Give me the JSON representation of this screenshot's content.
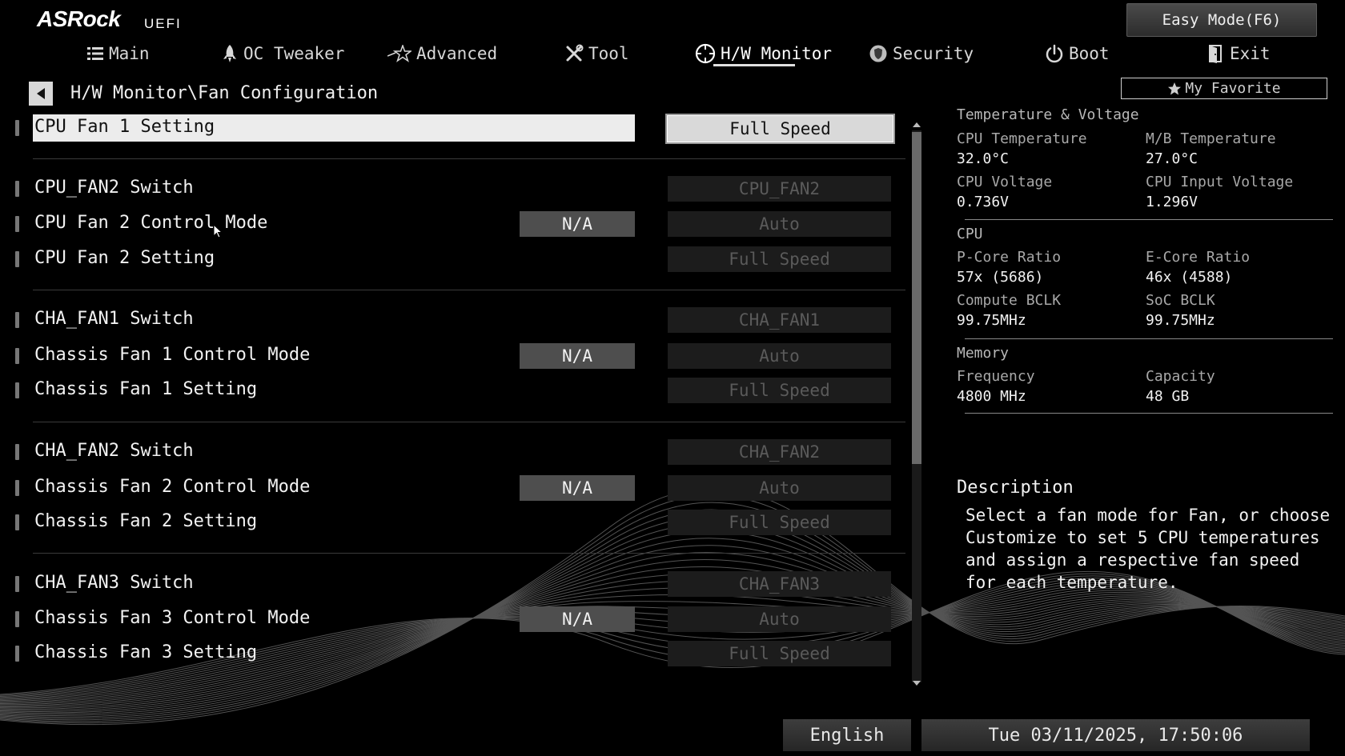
{
  "header": {
    "brand": "ASRock",
    "brand_suffix": "UEFI",
    "easy_mode_label": "Easy Mode(F6)"
  },
  "nav": {
    "tabs": [
      {
        "label": "Main",
        "icon": "list-icon"
      },
      {
        "label": "OC Tweaker",
        "icon": "rocket-icon"
      },
      {
        "label": "Advanced",
        "icon": "star-icon"
      },
      {
        "label": "Tool",
        "icon": "tools-icon"
      },
      {
        "label": "H/W Monitor",
        "icon": "monitor-icon",
        "active": true
      },
      {
        "label": "Security",
        "icon": "shield-icon"
      },
      {
        "label": "Boot",
        "icon": "power-icon"
      },
      {
        "label": "Exit",
        "icon": "exit-icon"
      }
    ]
  },
  "breadcrumb": {
    "path": "H/W Monitor\\Fan Configuration"
  },
  "favorite": {
    "label": "My Favorite"
  },
  "settings": [
    {
      "label": "CPU Fan 1 Setting",
      "value": "Full Speed",
      "selected": true
    },
    {
      "label": "CPU_FAN2 Switch",
      "value": "CPU_FAN2"
    },
    {
      "label": "CPU Fan 2 Control Mode",
      "status": "N/A",
      "value": "Auto"
    },
    {
      "label": "CPU Fan 2 Setting",
      "value": "Full Speed"
    },
    {
      "label": "CHA_FAN1 Switch",
      "value": "CHA_FAN1"
    },
    {
      "label": "Chassis Fan 1 Control Mode",
      "status": "N/A",
      "value": "Auto"
    },
    {
      "label": "Chassis Fan 1 Setting",
      "value": "Full Speed"
    },
    {
      "label": "CHA_FAN2 Switch",
      "value": "CHA_FAN2"
    },
    {
      "label": "Chassis Fan 2 Control Mode",
      "status": "N/A",
      "value": "Auto"
    },
    {
      "label": "Chassis Fan 2 Setting",
      "value": "Full Speed"
    },
    {
      "label": "CHA_FAN3 Switch",
      "value": "CHA_FAN3"
    },
    {
      "label": "Chassis Fan 3 Control Mode",
      "status": "N/A",
      "value": "Auto"
    },
    {
      "label": "Chassis Fan 3 Setting",
      "value": "Full Speed"
    }
  ],
  "info_panel": {
    "temp_voltage": {
      "title": "Temperature & Voltage",
      "cpu_temp_label": "CPU Temperature",
      "cpu_temp": "32.0°C",
      "mb_temp_label": "M/B Temperature",
      "mb_temp": "27.0°C",
      "cpu_voltage_label": "CPU Voltage",
      "cpu_voltage": "0.736V",
      "cpu_input_voltage_label": "CPU Input Voltage",
      "cpu_input_voltage": "1.296V"
    },
    "cpu": {
      "title": "CPU",
      "pcore_label": "P-Core Ratio",
      "pcore": "57x (5686)",
      "ecore_label": "E-Core Ratio",
      "ecore": "46x (4588)",
      "bclk_label": "Compute BCLK",
      "bclk": "99.75MHz",
      "soc_label": "SoC BCLK",
      "soc": "99.75MHz"
    },
    "memory": {
      "title": "Memory",
      "freq_label": "Frequency",
      "freq": "4800 MHz",
      "cap_label": "Capacity",
      "cap": "48 GB"
    }
  },
  "description": {
    "title": "Description",
    "text": "Select a fan mode for Fan, or choose Customize to set 5 CPU temperatures and assign a respective fan speed for each temperature."
  },
  "footer": {
    "language": "English",
    "datetime": "Tue 03/11/2025, 17:50:06"
  }
}
